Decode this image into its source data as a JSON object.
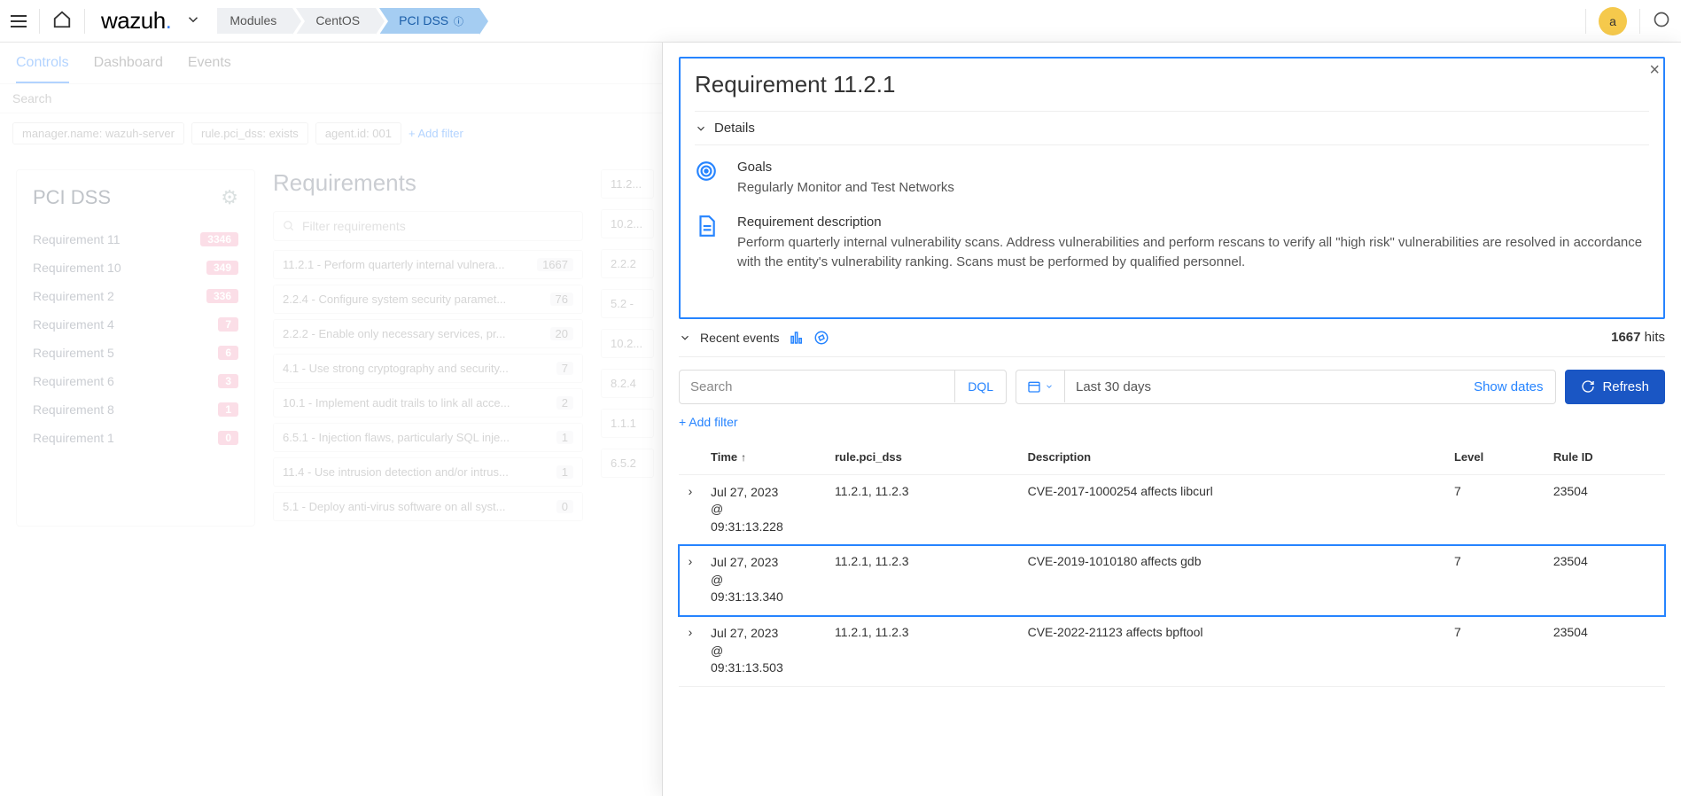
{
  "topbar": {
    "logo_text": "wazuh",
    "breadcrumbs": [
      "Modules",
      "CentOS",
      "PCI DSS"
    ],
    "avatar_letter": "a"
  },
  "tabs": [
    "Controls",
    "Dashboard",
    "Events"
  ],
  "searchbar_placeholder": "Search",
  "filters": [
    "manager.name: wazuh-server",
    "rule.pci_dss: exists",
    "agent.id: 001"
  ],
  "add_filter_label": "+ Add filter",
  "left_panel": {
    "title": "PCI DSS",
    "items": [
      {
        "label": "Requirement 11",
        "count": "3346"
      },
      {
        "label": "Requirement 10",
        "count": "349"
      },
      {
        "label": "Requirement 2",
        "count": "336"
      },
      {
        "label": "Requirement 4",
        "count": "7"
      },
      {
        "label": "Requirement 5",
        "count": "6"
      },
      {
        "label": "Requirement 6",
        "count": "3"
      },
      {
        "label": "Requirement 8",
        "count": "1"
      },
      {
        "label": "Requirement 1",
        "count": "0"
      }
    ]
  },
  "mid_panel": {
    "title": "Requirements",
    "filter_placeholder": "Filter requirements",
    "rows": [
      {
        "label": "11.2.1 - Perform quarterly internal vulnera...",
        "count": "1667"
      },
      {
        "label": "2.2.4 - Configure system security paramet...",
        "count": "76"
      },
      {
        "label": "2.2.2 - Enable only necessary services, pr...",
        "count": "20"
      },
      {
        "label": "4.1 - Use strong cryptography and security...",
        "count": "7"
      },
      {
        "label": "10.1 - Implement audit trails to link all acce...",
        "count": "2"
      },
      {
        "label": "6.5.1 - Injection flaws, particularly SQL inje...",
        "count": "1"
      },
      {
        "label": "11.4 - Use intrusion detection and/or intrus...",
        "count": "1"
      },
      {
        "label": "5.1 - Deploy anti-virus software on all syst...",
        "count": "0"
      }
    ],
    "subs": [
      "11.2...",
      "10.2...",
      "2.2.2",
      "5.2 -",
      "10.2...",
      "8.2.4",
      "1.1.1",
      "6.5.2"
    ]
  },
  "flyout": {
    "title": "Requirement 11.2.1",
    "details_label": "Details",
    "goals_label": "Goals",
    "goals_value": "Regularly Monitor and Test Networks",
    "req_desc_label": "Requirement description",
    "req_desc_value": "Perform quarterly internal vulnerability scans. Address vulnerabilities and perform rescans to verify all \"high risk\" vulnerabilities are resolved in accordance with the entity's vulnerability ranking. Scans must be performed by qualified personnel.",
    "recent_label": "Recent events",
    "hits_count": "1667",
    "hits_label": "hits",
    "search_placeholder": "Search",
    "dql_label": "DQL",
    "date_range": "Last 30 days",
    "show_dates": "Show dates",
    "refresh_label": "Refresh",
    "add_filter": "+ Add filter",
    "columns": {
      "time": "Time",
      "rule": "rule.pci_dss",
      "desc": "Description",
      "level": "Level",
      "ruleid": "Rule ID"
    },
    "rows": [
      {
        "time": "Jul 27, 2023 @ 09:31:13.228",
        "rule": "11.2.1, 11.2.3",
        "desc": "CVE-2017-1000254 affects libcurl",
        "level": "7",
        "rid": "23504",
        "hl": false
      },
      {
        "time": "Jul 27, 2023 @ 09:31:13.340",
        "rule": "11.2.1, 11.2.3",
        "desc": "CVE-2019-1010180 affects gdb",
        "level": "7",
        "rid": "23504",
        "hl": true
      },
      {
        "time": "Jul 27, 2023 @ 09:31:13.503",
        "rule": "11.2.1, 11.2.3",
        "desc": "CVE-2022-21123 affects bpftool",
        "level": "7",
        "rid": "23504",
        "hl": false
      }
    ]
  }
}
